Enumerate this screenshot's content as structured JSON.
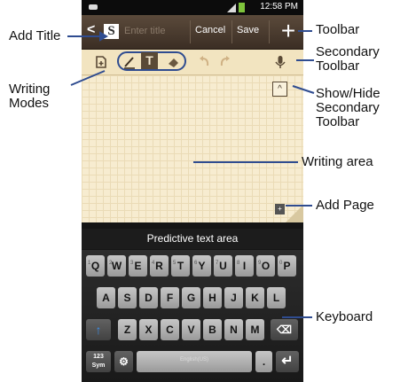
{
  "phone": {
    "status_time": "12:58 PM",
    "toolbar": {
      "back_glyph": "<",
      "logo_letter": "S",
      "title_placeholder": "Enter title",
      "cancel_label": "Cancel",
      "save_label": "Save",
      "add_glyph": "+"
    },
    "secondary_toolbar": {
      "t_mode_glyph": "T",
      "collapse_glyph": "^"
    },
    "add_page_glyph": "+",
    "predictive_text": "Predictive text area",
    "keyboard": {
      "row1": [
        "Q",
        "W",
        "E",
        "R",
        "T",
        "Y",
        "U",
        "I",
        "O",
        "P"
      ],
      "row1_alt": [
        "1",
        "2",
        "3",
        "4",
        "5",
        "6",
        "7",
        "8",
        "9",
        "0"
      ],
      "row2": [
        "A",
        "S",
        "D",
        "F",
        "G",
        "H",
        "J",
        "K",
        "L"
      ],
      "row3": [
        "Z",
        "X",
        "C",
        "V",
        "B",
        "N",
        "M"
      ],
      "sym_label": "123 Sym",
      "space_label": "English(US)",
      "period": ".",
      "enter_glyph": "↵",
      "shift_glyph": "↑",
      "delete_glyph": "⌫",
      "settings_glyph": "⚙"
    }
  },
  "callouts": {
    "add_title": "Add Title",
    "toolbar": "Toolbar",
    "writing_modes": "Writing Modes",
    "secondary_toolbar": "Secondary Toolbar",
    "show_hide": "Show/Hide Secondary Toolbar",
    "writing_area": "Writing area",
    "add_page": "Add Page",
    "keyboard": "Keyboard"
  },
  "colors": {
    "toolbar": "#4a3a2e",
    "paper": "#f7ecd0",
    "leader_line": "#2f4c90",
    "battery": "#7ec43b"
  }
}
